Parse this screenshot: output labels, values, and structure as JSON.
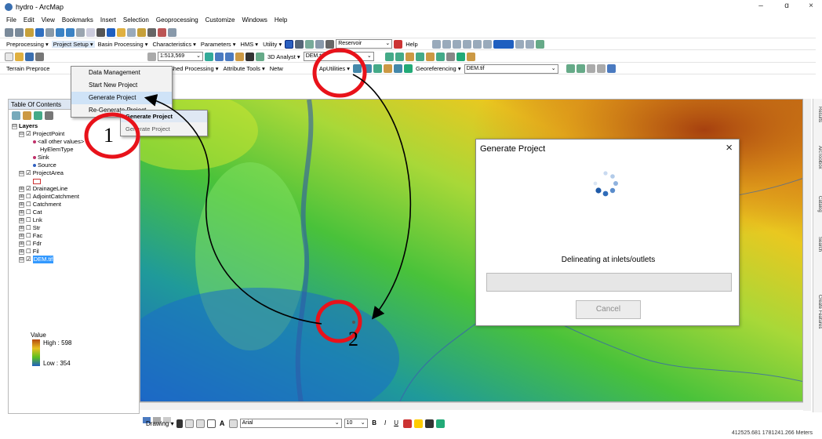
{
  "window": {
    "title": "hydro - ArcMap",
    "minimize": "–",
    "maximize": "ɑ",
    "close": "×"
  },
  "menubar": [
    "File",
    "Edit",
    "View",
    "Bookmarks",
    "Insert",
    "Selection",
    "Geoprocessing",
    "Customize",
    "Windows",
    "Help"
  ],
  "toolbar2": {
    "preprocessing": "Preprocessing ▾",
    "project_setup": "Project Setup ▾",
    "basin_processing": "Basin Processing ▾",
    "characteristics": "Characteristics ▾",
    "parameters": "Parameters ▾",
    "hms": "HMS ▾",
    "utility": "Utility ▾",
    "reservoir": "Reservoir",
    "help": "Help"
  },
  "toolbar3": {
    "scale": "1:513,569",
    "analyst": "3D Analyst ▾",
    "layer": "DEM.tif"
  },
  "toolbar4": {
    "terrain": "Terrain Preproce",
    "watershed": "Watershed Processing ▾",
    "attribute": "Attribute Tools ▾",
    "network": "Netw",
    "aputility": "ApUtilities ▾",
    "georef": "Georeferencing ▾",
    "georef_layer": "DEM.tif"
  },
  "toc": {
    "header": "Table Of Contents",
    "items": [
      {
        "label": "Layers",
        "indent": 0,
        "exp": "⊟",
        "check": ""
      },
      {
        "label": "ProjectPoint",
        "indent": 1,
        "exp": "⊟",
        "check": "☑"
      },
      {
        "label": "<all other values>",
        "indent": 3,
        "exp": "",
        "check": ""
      },
      {
        "label": "HyElemType",
        "indent": 4,
        "exp": "",
        "check": ""
      },
      {
        "label": "Sink",
        "indent": 3,
        "exp": "",
        "check": ""
      },
      {
        "label": "Source",
        "indent": 3,
        "exp": "",
        "check": ""
      },
      {
        "label": "ProjectArea",
        "indent": 1,
        "exp": "⊟",
        "check": "☑"
      },
      {
        "label": "",
        "indent": 3,
        "exp": "",
        "check": ""
      },
      {
        "label": "DrainageLine",
        "indent": 1,
        "exp": "⊞",
        "check": "☑"
      },
      {
        "label": "AdjointCatchment",
        "indent": 1,
        "exp": "⊞",
        "check": "☐"
      },
      {
        "label": "Catchment",
        "indent": 1,
        "exp": "⊞",
        "check": "☐"
      },
      {
        "label": "Cat",
        "indent": 1,
        "exp": "⊞",
        "check": "☐"
      },
      {
        "label": "Lnk",
        "indent": 1,
        "exp": "⊞",
        "check": "☐"
      },
      {
        "label": "Str",
        "indent": 1,
        "exp": "⊞",
        "check": "☐"
      },
      {
        "label": "Fac",
        "indent": 1,
        "exp": "⊞",
        "check": "☐"
      },
      {
        "label": "Fdr",
        "indent": 1,
        "exp": "⊞",
        "check": "☐"
      },
      {
        "label": "Fil",
        "indent": 1,
        "exp": "⊞",
        "check": "☐"
      },
      {
        "label": "DEM.tif",
        "indent": 1,
        "exp": "⊟",
        "check": "☑"
      }
    ],
    "legend_value": "Value",
    "legend_high": "High : 598",
    "legend_low": "Low : 354"
  },
  "project_menu": {
    "items": [
      "Data Management",
      "Start New Project",
      "Generate Project",
      "Re-Generate Project"
    ],
    "highlighted_index": 2
  },
  "submenu": {
    "title": "Generate Project",
    "item": "Generate Project"
  },
  "dialog": {
    "title": "Generate Project",
    "close": "×",
    "message": "Delineating at inlets/outlets",
    "progress_fraction": 0,
    "cancel": "Cancel"
  },
  "annotations": {
    "one": "1",
    "two": "2"
  },
  "drawbar": {
    "drawing": "Drawing ▾",
    "font": "Arial",
    "size": "10"
  },
  "status": {
    "coords": "412525.681  1781241.266 Meters"
  },
  "right_tabs": [
    "Results",
    "ArcToolbox",
    "Catalog",
    "Search",
    "Create Features"
  ],
  "colors": {
    "accent": "#3399ff",
    "annotation_red": "#e8121a",
    "dem_high": "#b44a10",
    "dem_low": "#1f5fc0"
  }
}
